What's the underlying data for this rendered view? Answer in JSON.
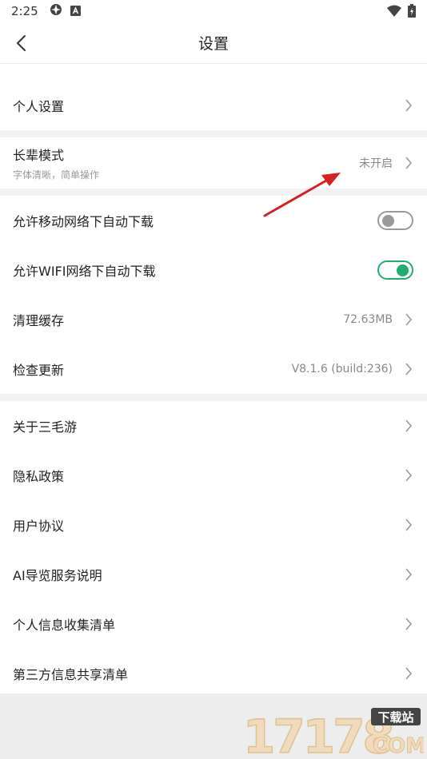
{
  "status_bar": {
    "time": "2:25",
    "left_icons": [
      "vpn-icon",
      "a-badge-icon"
    ],
    "right_icons": [
      "wifi-icon",
      "battery-icon"
    ]
  },
  "nav": {
    "title": "设置",
    "back_icon": "back-arrow-icon"
  },
  "settings": {
    "personal": {
      "label": "个人设置"
    },
    "elder_mode": {
      "label": "长辈模式",
      "sublabel": "字体清晰，简单操作",
      "value": "未开启"
    },
    "mobile_download": {
      "label": "允许移动网络下自动下载",
      "enabled": false
    },
    "wifi_download": {
      "label": "允许WIFI网络下自动下载",
      "enabled": true
    },
    "clear_cache": {
      "label": "清理缓存",
      "value": "72.63MB"
    },
    "check_update": {
      "label": "检查更新",
      "value": "V8.1.6 (build:236)"
    },
    "about": {
      "label": "关于三毛游"
    },
    "privacy": {
      "label": "隐私政策"
    },
    "user_agreement": {
      "label": "用户协议"
    },
    "ai_guide": {
      "label": "AI导览服务说明"
    },
    "personal_info": {
      "label": "个人信息收集清单"
    },
    "third_party": {
      "label": "第三方信息共享清单"
    }
  },
  "watermark": {
    "number": "17178",
    "tag": "下载站",
    "suffix": "COM"
  },
  "colors": {
    "toggle_on": "#1fae6c",
    "toggle_off": "#9a9a9a",
    "annotation_arrow": "#d42222",
    "watermark": "#e6c89a"
  }
}
